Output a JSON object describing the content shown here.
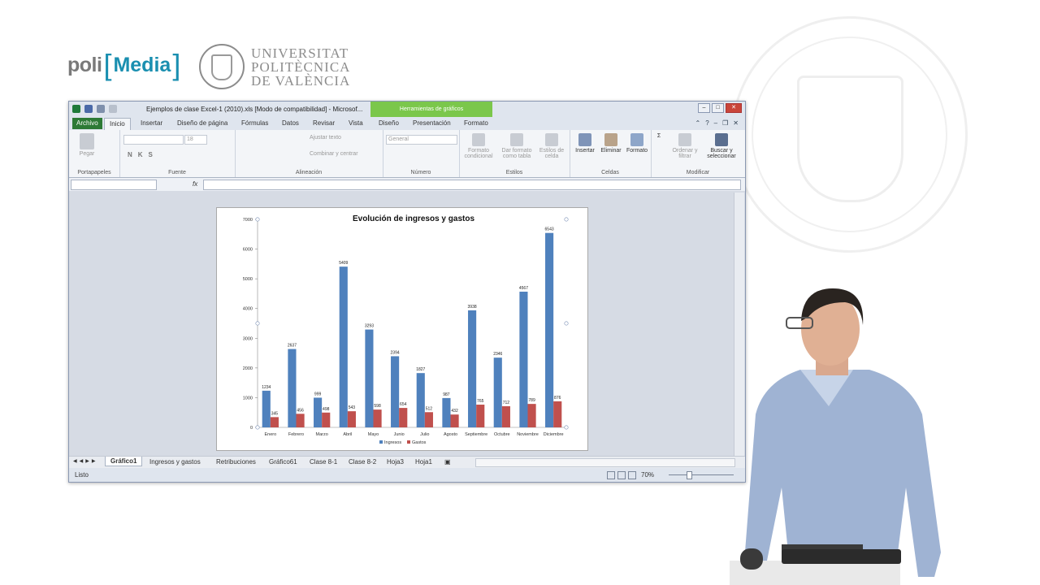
{
  "branding": {
    "poli_part1": "poli",
    "poli_bracket_open": "[",
    "poli_part2": "Media",
    "poli_bracket_close": "]",
    "upv_line1": "UNIVERSITAT",
    "upv_line2": "POLITÈCNICA",
    "upv_line3": "DE VALÈNCIA"
  },
  "excel": {
    "document_title": "Ejemplos de clase Excel-1 (2010).xls  [Modo de compatibilidad] - Microsof...",
    "contextual_tab_group": "Herramientas de gráficos",
    "tabs": [
      "Archivo",
      "Inicio",
      "Insertar",
      "Diseño de página",
      "Fórmulas",
      "Datos",
      "Revisar",
      "Vista",
      "Diseño",
      "Presentación",
      "Formato"
    ],
    "ribbon": {
      "paste": "Pegar",
      "font_size": "18",
      "wrap_text": "Ajustar texto",
      "merge_center": "Combinar y centrar",
      "number_format": "General",
      "conditional_format": "Formato condicional",
      "format_as_table": "Dar formato como tabla",
      "cell_styles": "Estilos de celda",
      "insert": "Insertar",
      "delete": "Eliminar",
      "format": "Formato",
      "sort_filter": "Ordenar y filtrar",
      "find_select": "Buscar y seleccionar",
      "groups": [
        "Portapapeles",
        "Fuente",
        "Alineación",
        "Número",
        "Estilos",
        "Celdas",
        "Modificar"
      ]
    },
    "formula_symbol": "fx",
    "sheet_tabs": [
      "Gráfico1",
      "Ingresos y gastos",
      "Retribuciones",
      "Gráfico61",
      "Clase 8-1",
      "Clase 8-2",
      "Hoja3",
      "Hoja1"
    ],
    "status": "Listo",
    "zoom": "70%"
  },
  "chart_data": {
    "type": "bar",
    "title": "Evolución de ingresos y gastos",
    "categories": [
      "Enero",
      "Febrero",
      "Marzo",
      "Abril",
      "Mayo",
      "Junio",
      "Julio",
      "Agosto",
      "Septiembre",
      "Octubre",
      "Noviembre",
      "Diciembre"
    ],
    "series": [
      {
        "name": "Ingresos",
        "color": "#4f81bd",
        "values": [
          1234,
          2637,
          999,
          5409,
          3293,
          2394,
          1827,
          987,
          3938,
          2346,
          4567,
          6543
        ]
      },
      {
        "name": "Gastos",
        "color": "#c0504d",
        "values": [
          345,
          456,
          498,
          543,
          598,
          654,
          512,
          432,
          765,
          712,
          789,
          876
        ]
      }
    ],
    "ylim": [
      0,
      7000
    ],
    "yticks": [
      0,
      1000,
      2000,
      3000,
      4000,
      5000,
      6000,
      7000
    ],
    "legend_position": "bottom",
    "grid": false,
    "data_labels": true
  }
}
